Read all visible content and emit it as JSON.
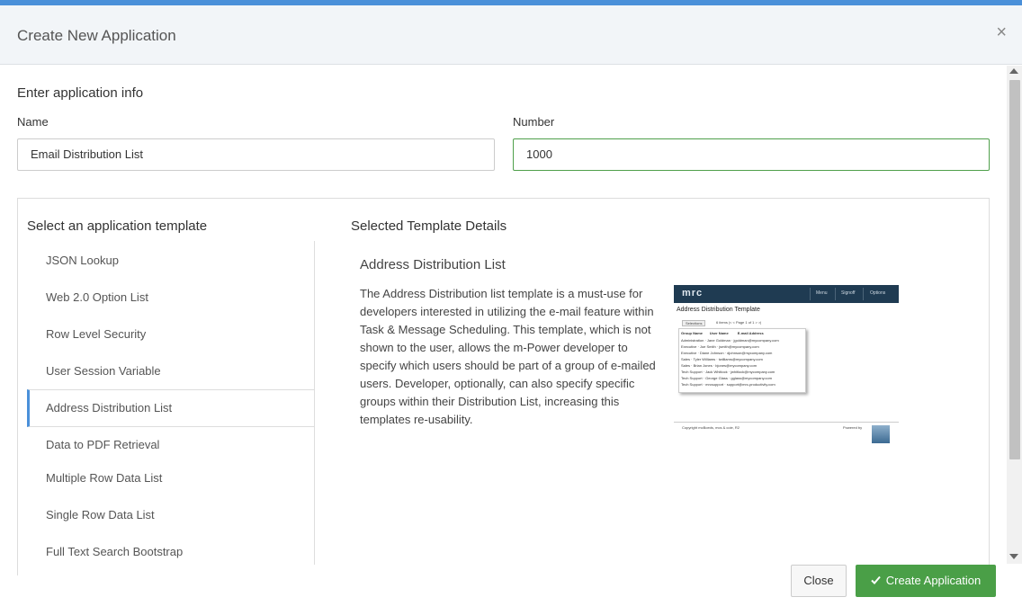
{
  "dialog": {
    "title": "Create New Application",
    "close_glyph": "×"
  },
  "info": {
    "section_label": "Enter application info",
    "name_label": "Name",
    "name_value": "Email Distribution List",
    "number_label": "Number",
    "number_value": "1000"
  },
  "templates": {
    "title": "Select an application template",
    "items": [
      {
        "label": "JSON Lookup"
      },
      {
        "label": "Web 2.0 Option List"
      },
      {
        "label": "Row Level Security"
      },
      {
        "label": "User Session Variable"
      },
      {
        "label": "Address Distribution List"
      },
      {
        "label": "Data to PDF Retrieval"
      },
      {
        "label": "Multiple Row Data List"
      },
      {
        "label": "Single Row Data List"
      },
      {
        "label": "Full Text Search Bootstrap"
      }
    ],
    "selected": "Address Distribution List"
  },
  "details": {
    "title": "Selected Template Details",
    "name": "Address Distribution List",
    "description": "The Address Distribution list template is a must-use for developers interested in utilizing the e-mail feature within Task & Message Scheduling. This template, which is not shown to the user, allows the m-Power developer to specify which users should be part of a group of e-mailed users. Developer, optionally, can also specify specific groups within their Distribution List, increasing this templates re-usability."
  },
  "preview": {
    "logo": "mrc",
    "nav": [
      "Menu",
      "Signoff",
      "Options"
    ],
    "heading": "Address Distribution Template",
    "selections": "Selections",
    "pager": "6 items   |<   <   Page 1 of 1   >   >|",
    "columns": [
      "Group Name",
      "User Name",
      "E-mail Address"
    ],
    "rows": [
      [
        "Administration",
        "Jane Goldman",
        "jgoldman@mycompany.com"
      ],
      [
        "Executive",
        "Joe Smith",
        "jsmith@mycompany.com"
      ],
      [
        "Executive",
        "Diane Johnson",
        "djohnson@mycompany.com"
      ],
      [
        "Sales",
        "Tyler Williams",
        "twilliams@mycompany.com"
      ],
      [
        "Sales",
        "Brian Jones",
        "bjones@mycompany.com"
      ],
      [
        "Tech Support",
        "Jack Whitlock",
        "jwhitlock@mycompany.com"
      ],
      [
        "Tech Support",
        "George Glass",
        "gglass@mycompany.com"
      ],
      [
        "Tech Support",
        "mrcsupport",
        "support@mrc-productivity.com"
      ]
    ],
    "copyright": "Copyright mcBoeds, mcs & coie, R2",
    "powered_by": "Powered by"
  },
  "footer": {
    "close_label": "Close",
    "create_label": "Create Application",
    "create_icon": "check-icon"
  },
  "colors": {
    "accent": "#4a90d9",
    "success": "#4a9f47"
  }
}
